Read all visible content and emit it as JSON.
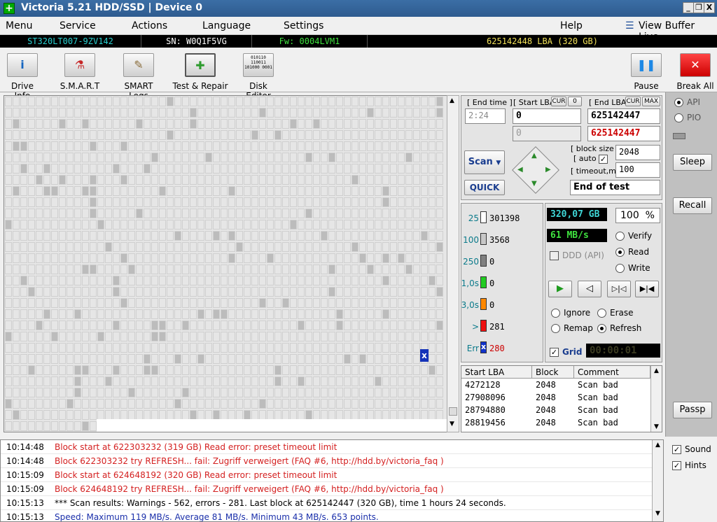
{
  "window": {
    "title": "Victoria 5.21 HDD/SSD | Device 0",
    "btn_min": "_",
    "btn_max": "❐",
    "btn_close": "X"
  },
  "menubar": {
    "items": [
      "Menu",
      "Service",
      "Actions",
      "Language",
      "Settings"
    ],
    "help": "Help",
    "view_buffer": "View Buffer Live"
  },
  "infobar": {
    "model": "ST320LT007-9ZV142",
    "serial": "SN: W0Q1F5VG",
    "firmware": "Fw: 0004LVM1",
    "capacity": "625142448 LBA (320 GB)"
  },
  "toolbar": {
    "drive_info": "Drive Info",
    "smart": "S.M.A.R.T",
    "smart_logs": "SMART Logs",
    "test_repair": "Test & Repair",
    "disk_editor": "Disk Editor",
    "disk_editor_icon_text": "010110 110011 101000 0001",
    "pause": "Pause",
    "break_all": "Break All"
  },
  "scan": {
    "end_time_label": "[ End time ]",
    "end_time_value": "2:24",
    "start_lba_label": "[ Start LBA]",
    "start_cur": "CUR",
    "start_zero": "0",
    "start_lba": "0",
    "start_lba2": "0",
    "end_lba_label": "[ End LBA]",
    "end_cur": "CUR",
    "end_max": "MAX",
    "end_lba": "625142447",
    "end_lba2": "625142447",
    "scan_button": "Scan",
    "quick_button": "QUICK",
    "block_size_label": "[ block size ]",
    "auto_label": "[ auto ]",
    "block_size": "2048",
    "timeout_label": "[ timeout,ms ]",
    "timeout": "100",
    "end_action": "End of test"
  },
  "counters": [
    {
      "label": "25",
      "value": "301398",
      "color": "#ffffff"
    },
    {
      "label": "100",
      "value": "3568",
      "color": "#c8c8c8"
    },
    {
      "label": "250",
      "value": "0",
      "color": "#808080"
    },
    {
      "label": "1,0s",
      "value": "0",
      "color": "#22cc22"
    },
    {
      "label": "3,0s",
      "value": "0",
      "color": "#ff8800"
    },
    {
      "label": ">",
      "value": "281",
      "color": "#ee1111"
    },
    {
      "label": "Err",
      "value": "280",
      "color": "#1133cc",
      "box_text": "x"
    }
  ],
  "status": {
    "size": "320,07 GB",
    "percent": "100",
    "percent_sign": "%",
    "speed": "61 MB/s",
    "ddd": "DDD (API)",
    "verify": "Verify",
    "read": "Read",
    "write": "Write",
    "ignore": "Ignore",
    "erase": "Erase",
    "remap": "Remap",
    "refresh": "Refresh",
    "grid": "Grid",
    "timer": "00:00:01"
  },
  "bad_table": {
    "headers": [
      "Start LBA",
      "Block",
      "Comment"
    ],
    "rows": [
      {
        "lba": "4272128",
        "block": "2048",
        "comment": "Scan bad"
      },
      {
        "lba": "27908096",
        "block": "2048",
        "comment": "Scan bad"
      },
      {
        "lba": "28794880",
        "block": "2048",
        "comment": "Scan bad"
      },
      {
        "lba": "28819456",
        "block": "2048",
        "comment": "Scan bad"
      }
    ]
  },
  "log": [
    {
      "time": "10:14:48",
      "msg": "Block start at 622303232 (319 GB) Read error: preset timeout limit",
      "color": "#d42020"
    },
    {
      "time": "10:14:48",
      "msg": "Block 622303232 try REFRESH... fail: Zugriff verweigert (FAQ #6, http://hdd.by/victoria_faq )",
      "color": "#d42020"
    },
    {
      "time": "10:15:09",
      "msg": "Block start at 624648192 (320 GB) Read error: preset timeout limit",
      "color": "#d42020"
    },
    {
      "time": "10:15:09",
      "msg": "Block 624648192 try REFRESH... fail: Zugriff verweigert (FAQ #6, http://hdd.by/victoria_faq )",
      "color": "#d42020"
    },
    {
      "time": "10:15:13",
      "msg": "*** Scan results: Warnings - 562, errors - 281. Last block at 625142447 (320 GB), time 1 hours 24 seconds.",
      "color": "#000000"
    },
    {
      "time": "10:15:13",
      "msg": "Speed: Maximum 119 MB/s. Average 81 MB/s. Minimum 43 MB/s. 653 points.",
      "color": "#1a2faa"
    }
  ],
  "sidebar": {
    "api": "API",
    "pio": "PIO",
    "sleep": "Sleep",
    "recall": "Recall",
    "passp": "Passp",
    "sound": "Sound",
    "hints": "Hints"
  },
  "map": {
    "error_marker": "x"
  }
}
